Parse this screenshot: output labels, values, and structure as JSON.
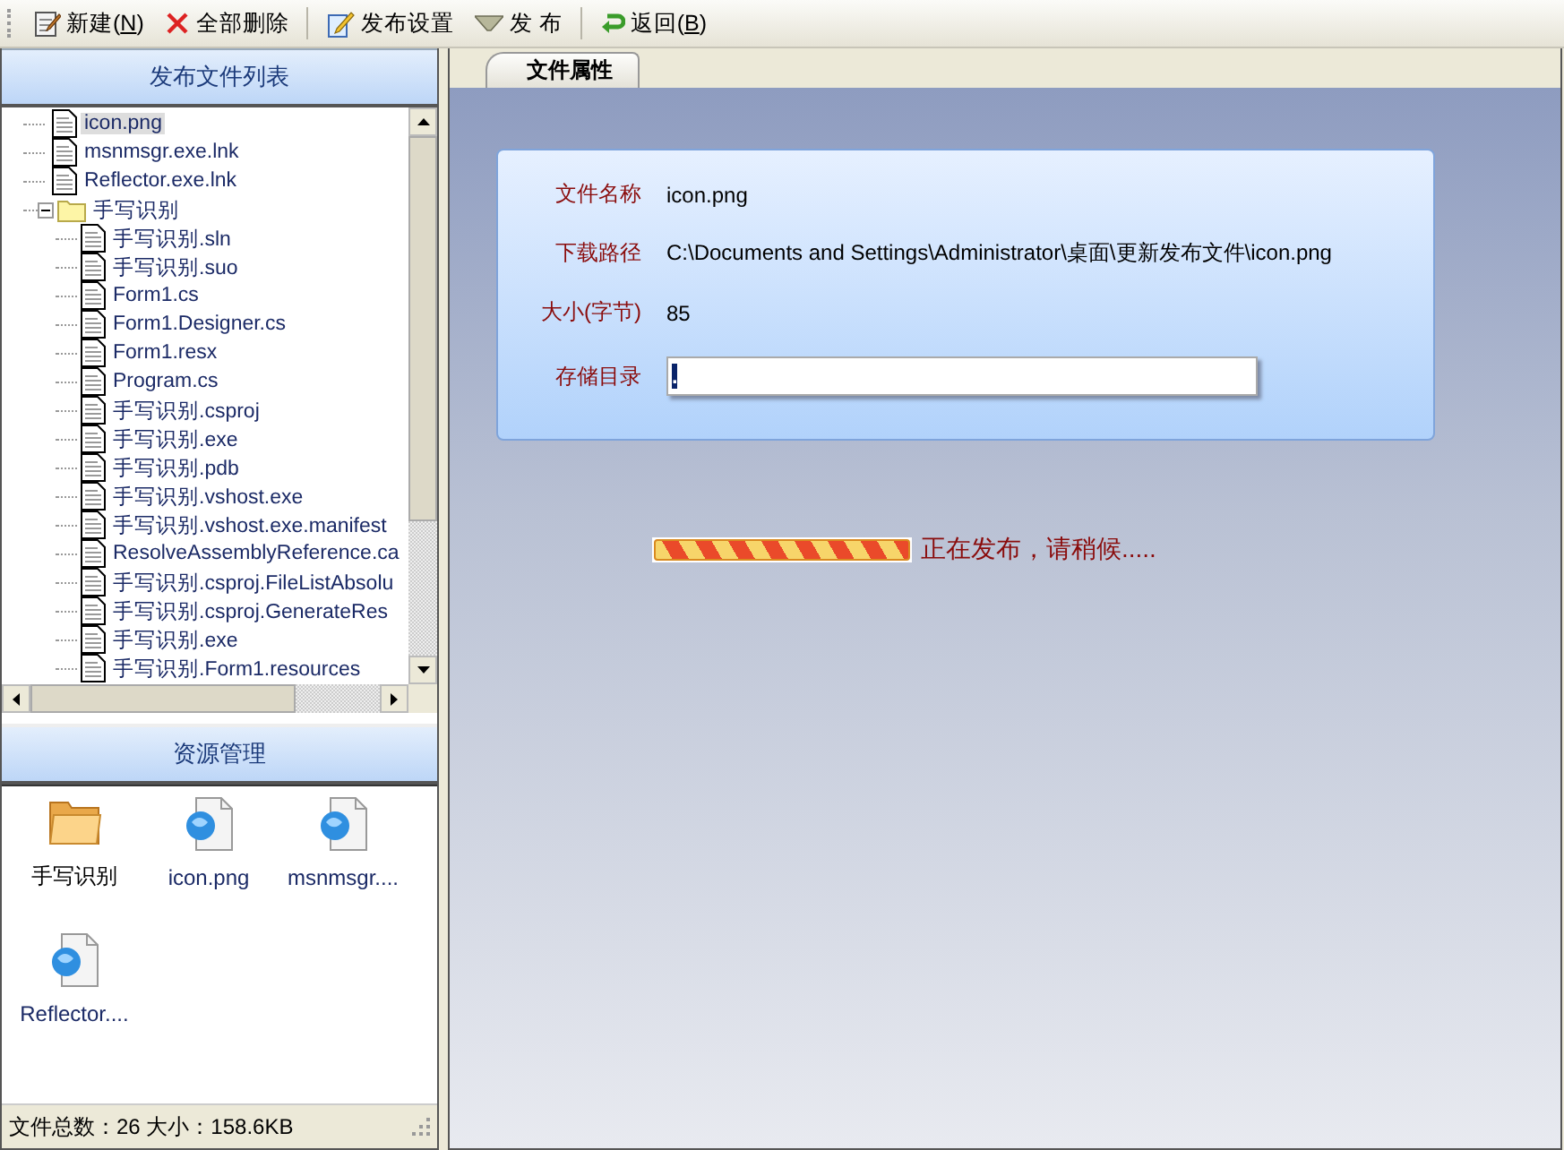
{
  "toolbar": [
    {
      "kind": "new",
      "label": "新建(",
      "key": "N",
      "tail": ")"
    },
    {
      "kind": "delete",
      "label": "全部删除"
    },
    {
      "kind": "settings",
      "label": "发布设置"
    },
    {
      "kind": "publish",
      "label": "发 布"
    },
    {
      "kind": "back",
      "label": "返回(",
      "key": "B",
      "tail": ")"
    }
  ],
  "file_list": {
    "title": "发布文件列表",
    "items": [
      {
        "kind": "file",
        "name": "icon.png",
        "selected": true
      },
      {
        "kind": "file",
        "name": "msnmsgr.exe.lnk",
        "selected": false
      },
      {
        "kind": "file",
        "name": "Reflector.exe.lnk",
        "selected": false
      },
      {
        "kind": "folder",
        "name": "手写识别",
        "selected": false,
        "expanded": true,
        "children": [
          {
            "kind": "file",
            "name": "手写识别.sln",
            "selected": false
          },
          {
            "kind": "file",
            "name": "手写识别.suo",
            "selected": false
          },
          {
            "kind": "file",
            "name": "Form1.cs",
            "selected": false
          },
          {
            "kind": "file",
            "name": "Form1.Designer.cs",
            "selected": false
          },
          {
            "kind": "file",
            "name": "Form1.resx",
            "selected": false
          },
          {
            "kind": "file",
            "name": "Program.cs",
            "selected": false
          },
          {
            "kind": "file",
            "name": "手写识别.csproj",
            "selected": false
          },
          {
            "kind": "file",
            "name": "手写识别.exe",
            "selected": false
          },
          {
            "kind": "file",
            "name": "手写识别.pdb",
            "selected": false
          },
          {
            "kind": "file",
            "name": "手写识别.vshost.exe",
            "selected": false
          },
          {
            "kind": "file",
            "name": "手写识别.vshost.exe.manifest",
            "selected": false
          },
          {
            "kind": "file",
            "name": "ResolveAssemblyReference.ca",
            "selected": false
          },
          {
            "kind": "file",
            "name": "手写识别.csproj.FileListAbsolu",
            "selected": false
          },
          {
            "kind": "file",
            "name": "手写识别.csproj.GenerateRes",
            "selected": false
          },
          {
            "kind": "file",
            "name": "手写识别.exe",
            "selected": false
          },
          {
            "kind": "file",
            "name": "手写识别.Form1.resources",
            "selected": false
          }
        ]
      }
    ]
  },
  "resources": {
    "title": "资源管理",
    "items": [
      {
        "kind": "folder",
        "name": "手写识别"
      },
      {
        "kind": "file",
        "name": "icon.png"
      },
      {
        "kind": "file",
        "name": "msnmsgr...."
      },
      {
        "kind": "file",
        "name": "Reflector...."
      }
    ]
  },
  "status_bar": "文件总数：26 大小：158.6KB",
  "tabs": [
    {
      "label": "文件属性",
      "selected": true
    }
  ],
  "properties": [
    {
      "label": "文件名称",
      "value": "icon.png"
    },
    {
      "label": "下载路径",
      "value": "C:\\Documents and Settings\\Administrator\\桌面\\更新发布文件\\icon.png"
    },
    {
      "label": "大小(字节)",
      "value": "85"
    }
  ],
  "storage_dir": {
    "label": "存储目录",
    "value": "."
  },
  "progress": {
    "level": 1,
    "message": "正在发布，请稍候....."
  }
}
